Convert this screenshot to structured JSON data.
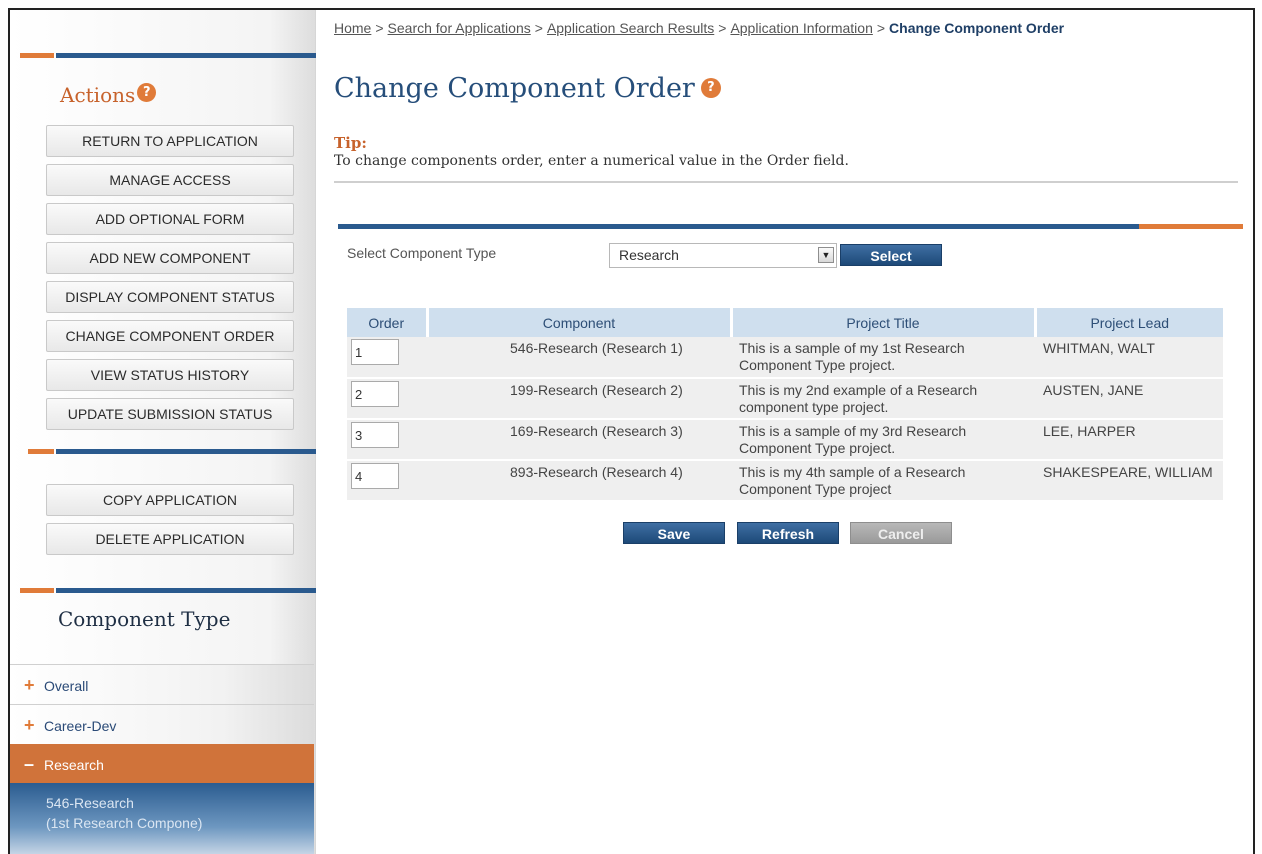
{
  "breadcrumb": {
    "items": [
      "Home",
      "Search for Applications",
      "Application Search Results",
      "Application Information"
    ],
    "separator": ">",
    "current": "Change Component Order"
  },
  "sidebar": {
    "actions_title": "Actions",
    "help_icon": "?",
    "action_buttons": [
      "RETURN TO APPLICATION",
      "MANAGE ACCESS",
      "ADD OPTIONAL FORM",
      "ADD NEW COMPONENT",
      "DISPLAY COMPONENT STATUS",
      "CHANGE COMPONENT ORDER",
      "VIEW STATUS HISTORY",
      "UPDATE SUBMISSION STATUS"
    ],
    "app_buttons": [
      "COPY APPLICATION",
      "DELETE APPLICATION"
    ],
    "component_type_title": "Component Type",
    "tree": [
      {
        "sign": "+",
        "label": "Overall",
        "active": false
      },
      {
        "sign": "+",
        "label": "Career-Dev",
        "active": false
      },
      {
        "sign": "–",
        "label": "Research",
        "active": true
      }
    ],
    "sub_item": {
      "line1": "546-Research",
      "line2": "(1st Research Compone)"
    }
  },
  "main": {
    "title": "Change Component Order",
    "help_icon": "?",
    "tip_label": "Tip:",
    "tip_text": "To change components order, enter a numerical value in the Order field.",
    "select_label": "Select Component Type",
    "select_value": "Research",
    "select_button": "Select",
    "table": {
      "columns": [
        "Order",
        "Component",
        "Project Title",
        "Project Lead"
      ],
      "rows": [
        {
          "order": "1",
          "component": "546-Research (Research 1)",
          "title": "This is a sample of my 1st Research Component Type project.",
          "lead": "WHITMAN, WALT"
        },
        {
          "order": "2",
          "component": "199-Research (Research 2)",
          "title": "This is my 2nd example of a Research component type project.",
          "lead": "AUSTEN, JANE"
        },
        {
          "order": "3",
          "component": "169-Research (Research 3)",
          "title": "This is a sample of my 3rd Research Component Type project.",
          "lead": "LEE, HARPER"
        },
        {
          "order": "4",
          "component": "893-Research (Research 4)",
          "title": "This is my 4th sample of a Research Component Type project",
          "lead": "SHAKESPEARE, WILLIAM"
        }
      ]
    },
    "buttons": {
      "save": "Save",
      "refresh": "Refresh",
      "cancel": "Cancel"
    }
  },
  "colors": {
    "accent_orange": "#e07b39",
    "accent_blue": "#2a5a8e",
    "header_blue": "#cfdfee"
  }
}
